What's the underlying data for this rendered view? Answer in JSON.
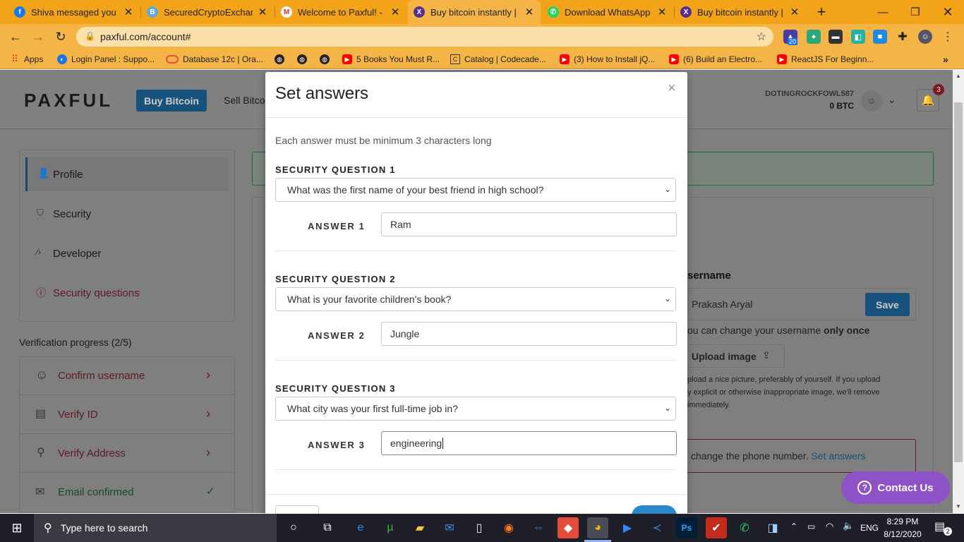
{
  "browser": {
    "tabs": [
      {
        "title": "Shiva messaged you",
        "color": "#1877f2",
        "glyph": "f",
        "icon": "facebook-icon"
      },
      {
        "title": "SecuredCryptoExchang",
        "color": "#5fa8e0",
        "glyph": "B",
        "icon": "bitcoin-icon"
      },
      {
        "title": "Welcome to Paxful! - ar",
        "color": "#d93025",
        "glyph": "M",
        "icon": "gmail-icon"
      },
      {
        "title": "Buy bitcoin instantly | P",
        "color": "#5a2d91",
        "glyph": "X",
        "icon": "paxful-icon"
      },
      {
        "title": "Download WhatsApp",
        "color": "#25d366",
        "glyph": "✆",
        "icon": "whatsapp-icon"
      },
      {
        "title": "Buy bitcoin instantly | P",
        "color": "#5a2d91",
        "glyph": "X",
        "icon": "paxful-icon"
      }
    ],
    "url": "paxful.com/account#",
    "bookmarks": [
      {
        "label": "Apps",
        "color": "#d93025",
        "icon": "apps-grid-icon"
      },
      {
        "label": "Login Panel : Suppo...",
        "color": "#1a73e8",
        "icon": "globe-icon"
      },
      {
        "label": "Database 12c | Ora...",
        "color": "#e74c3c",
        "icon": "oracle-icon"
      },
      {
        "label": "",
        "color": "#222222",
        "icon": "globe-icon"
      },
      {
        "label": "",
        "color": "#222222",
        "icon": "globe-icon"
      },
      {
        "label": "",
        "color": "#222222",
        "icon": "globe-icon"
      },
      {
        "label": "5 Books You Must R...",
        "color": "#ff0000",
        "icon": "youtube-icon"
      },
      {
        "label": "Catalog | Codecade...",
        "color": "#333333",
        "icon": "codecademy-icon"
      },
      {
        "label": "(3) How to Install jQ...",
        "color": "#ff0000",
        "icon": "youtube-icon"
      },
      {
        "label": "(6) Build an Electro...",
        "color": "#ff0000",
        "icon": "youtube-icon"
      },
      {
        "label": "ReactJS For Beginn...",
        "color": "#ff0000",
        "icon": "youtube-icon"
      }
    ],
    "ext_badge": "20"
  },
  "header": {
    "logo": "PAXFUL",
    "buy_button": "Buy Bitcoin",
    "sell_link": "Sell Bitco",
    "username": "DOTINGROCKFOWL587",
    "balance": "0 BTC",
    "notif_count": "3"
  },
  "sidebar": {
    "items": [
      {
        "label": "Profile",
        "icon": "user-icon"
      },
      {
        "label": "Security",
        "icon": "shield-icon"
      },
      {
        "label": "Developer",
        "icon": "code-icon"
      },
      {
        "label": "Security questions",
        "icon": "alert-circle-icon"
      }
    ],
    "progress_title": "Verification progress (2/5)",
    "progress_items": [
      {
        "label": "Confirm username",
        "icon": "user-alert-icon"
      },
      {
        "label": "Verify ID",
        "icon": "id-card-icon"
      },
      {
        "label": "Verify Address",
        "icon": "location-pin-icon"
      },
      {
        "label": "Email confirmed",
        "icon": "email-icon"
      }
    ]
  },
  "profile": {
    "username_label": "sername",
    "username_value": "Prakash Aryal",
    "save_button": "Save",
    "change_note_prefix": "ou can change your username ",
    "change_note_bold": "only once",
    "upload_button": "Upload image",
    "upload_note_1": "pload a nice picture, preferably of yourself. If you upload",
    "upload_note_2": "y explicit or otherwise inappropriate image, we'll remove",
    "upload_note_3": "immediately.",
    "phone_note": "change the phone number. ",
    "set_answers_link": "Set answers"
  },
  "contact_button": "Contact Us",
  "modal": {
    "title": "Set answers",
    "close": "×",
    "hint": "Each answer must be minimum 3 characters long",
    "questions": [
      {
        "label": "SECURITY QUESTION 1",
        "question": "What was the first name of your best friend in high school?",
        "answer_label": "ANSWER 1",
        "answer": "Ram"
      },
      {
        "label": "SECURITY QUESTION 2",
        "question": "What is your favorite children’s book?",
        "answer_label": "ANSWER 2",
        "answer": "Jungle"
      },
      {
        "label": "SECURITY QUESTION 3",
        "question": "What city was your first full-time job in?",
        "answer_label": "ANSWER 3",
        "answer": "engineering"
      }
    ]
  },
  "taskbar": {
    "search_placeholder": "Type here to search",
    "language": "ENG",
    "time": "8:29 PM",
    "date": "8/12/2020",
    "notifications": "2"
  },
  "colors": {
    "chrome_orange": "#f3a317",
    "paxful_blue": "#2b87c8",
    "error_red": "#c2364a",
    "success_green": "#2e9b57",
    "contact_purple": "#8e51c6"
  }
}
